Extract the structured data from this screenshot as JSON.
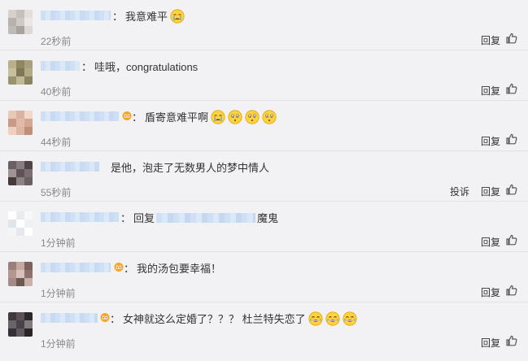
{
  "comments": [
    {
      "text": "我意难平",
      "emoji": [
        "crying"
      ],
      "time": "22秒前",
      "reply": "回复",
      "crown": false,
      "avatar": [
        "#d7d0cc",
        "#c6c0bb",
        "#e3dedb",
        "#b9b1ad",
        "#d0c9c4",
        "#ebe7e4",
        "#c0bab6",
        "#a9a29e",
        "#ddd8d5"
      ]
    },
    {
      "text": "哇哦，congratulations",
      "emoji": [],
      "time": "40秒前",
      "reply": "回复",
      "crown": false,
      "avatar": [
        "#b9b08a",
        "#8f8763",
        "#a8a07a",
        "#c7c09d",
        "#7d7657",
        "#b2aa86",
        "#9a936f",
        "#c0b995",
        "#8a8462"
      ]
    },
    {
      "text": "盾寄意难平啊",
      "emoji": [
        "crying",
        "surprised",
        "surprised",
        "surprised"
      ],
      "time": "44秒前",
      "reply": "回复",
      "crown": true,
      "avatar": [
        "#e8c9b8",
        "#d9b2a0",
        "#f0d8ca",
        "#c99a86",
        "#e2bba8",
        "#d4a792",
        "#efcfc0",
        "#dcb5a3",
        "#c08f7a"
      ]
    },
    {
      "text": "是他，泡走了无数男人的梦中情人",
      "emoji": [],
      "time": "55秒前",
      "reply": "回复",
      "report": "投诉",
      "crown": false,
      "avatar": [
        "#6b5f63",
        "#8a7d80",
        "#4f4548",
        "#9f9396",
        "#5e5457",
        "#7a6e71",
        "#433a3c",
        "#8e8285",
        "#6a5f61"
      ]
    },
    {
      "text": "回复",
      "mention_after": "魔鬼",
      "emoji": [],
      "time": "1分钟前",
      "reply": "回复",
      "crown": false,
      "avatar": [
        "#ffffff",
        "#e8ecf0",
        "#f6f8fa",
        "#dfe5ea",
        "#ffffff",
        "#eef2f5",
        "#f3f5f7",
        "#e5e9ed",
        "#ffffff"
      ]
    },
    {
      "text": "我的汤包要幸福！",
      "emoji": [],
      "time": "1分钟前",
      "reply": "回复",
      "crown": true,
      "avatar": [
        "#9a7f7a",
        "#c2a9a2",
        "#7b625d",
        "#b39790",
        "#d8c1ba",
        "#8d736d",
        "#a68a84",
        "#6f5752",
        "#c9b0a9"
      ]
    },
    {
      "text": "女神就这么定婚了？？？  杜兰特失恋了",
      "emoji": [
        "laughing",
        "laughing",
        "laughing"
      ],
      "time": "1分钟前",
      "reply": "回复",
      "crown": true,
      "avatar": [
        "#3e3a3e",
        "#5a5257",
        "#2c282b",
        "#6c6368",
        "#48424a",
        "#837a7f",
        "#34303a",
        "#5f585d",
        "#2a2628"
      ]
    }
  ],
  "colors": {
    "background": "#f2f2f5",
    "divider": "#e4e4e8",
    "time": "#888888",
    "crown": "#f5a623",
    "emoji_face": "#ffd23f"
  },
  "icons": {
    "like": "thumbs-up-icon",
    "crown": "crown-badge-icon"
  }
}
